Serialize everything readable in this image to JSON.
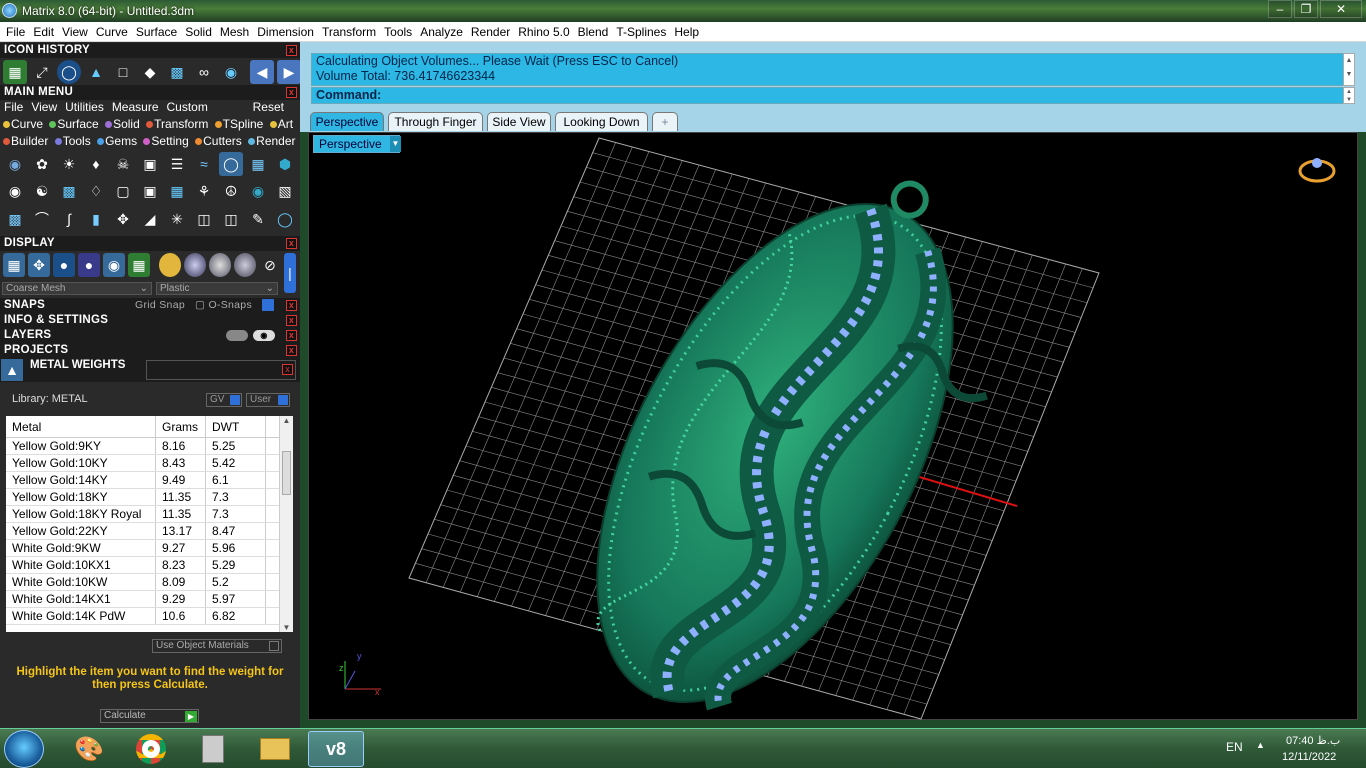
{
  "window": {
    "title": "Matrix 8.0 (64-bit) - Untitled.3dm"
  },
  "menu": [
    "File",
    "Edit",
    "View",
    "Curve",
    "Surface",
    "Solid",
    "Mesh",
    "Dimension",
    "Transform",
    "Tools",
    "Analyze",
    "Render",
    "Rhino 5.0",
    "Blend",
    "T-Splines",
    "Help"
  ],
  "left": {
    "icon_history": "ICON HISTORY",
    "main_menu": "MAIN MENU",
    "main_menu_items": [
      "File",
      "View",
      "Utilities",
      "Measure",
      "Custom"
    ],
    "reset": "Reset",
    "categories_row1": [
      {
        "label": "Curve",
        "color": "#e8c23a"
      },
      {
        "label": "Surface",
        "color": "#5fc45a"
      },
      {
        "label": "Solid",
        "color": "#9f6fd8"
      },
      {
        "label": "Transform",
        "color": "#e25a3c"
      },
      {
        "label": "TSpline",
        "color": "#f0a030"
      },
      {
        "label": "Art",
        "color": "#e6c23c"
      }
    ],
    "categories_row2": [
      {
        "label": "Builder",
        "color": "#e25a3c"
      },
      {
        "label": "Tools",
        "color": "#7a7adf"
      },
      {
        "label": "Gems",
        "color": "#4aa0e8"
      },
      {
        "label": "Setting",
        "color": "#d060c8"
      },
      {
        "label": "Cutters",
        "color": "#f08a30"
      },
      {
        "label": "Render",
        "color": "#5fb8e0"
      }
    ],
    "display": "DISPLAY",
    "mesh_option": "Coarse Mesh",
    "material_option": "Plastic",
    "snaps": "SNAPS",
    "grid_snap": "Grid Snap",
    "o_snaps": "O-Snaps",
    "info": "INFO & SETTINGS",
    "layers": "LAYERS",
    "projects": "PROJECTS",
    "metal_weights": "METAL WEIGHTS",
    "library": "Library: METAL",
    "gv": "GV",
    "user": "User",
    "columns": [
      "Metal",
      "Grams",
      "DWT"
    ],
    "rows": [
      [
        "Yellow Gold:9KY",
        "8.16",
        "5.25"
      ],
      [
        "Yellow Gold:10KY",
        "8.43",
        "5.42"
      ],
      [
        "Yellow Gold:14KY",
        "9.49",
        "6.1"
      ],
      [
        "Yellow Gold:18KY",
        "11.35",
        "7.3"
      ],
      [
        "Yellow Gold:18KY Royal",
        "11.35",
        "7.3"
      ],
      [
        "Yellow Gold:22KY",
        "13.17",
        "8.47"
      ],
      [
        "White Gold:9KW",
        "9.27",
        "5.96"
      ],
      [
        "White Gold:10KX1",
        "8.23",
        "5.29"
      ],
      [
        "White Gold:10KW",
        "8.09",
        "5.2"
      ],
      [
        "White Gold:14KX1",
        "9.29",
        "5.97"
      ],
      [
        "White Gold:14K PdW",
        "10.6",
        "6.82"
      ]
    ],
    "use_object_materials": "Use Object Materials",
    "hint": "Highlight the item you want to find the weight for then press Calculate.",
    "calculate": "Calculate"
  },
  "command": {
    "line1": "Calculating Object Volumes... Please Wait (Press ESC to Cancel)",
    "line2": "Volume Total: 736.41746623344",
    "prompt": "Command:"
  },
  "tabs": [
    "Perspective",
    "Through Finger",
    "Side View",
    "Looking Down",
    "+"
  ],
  "viewport": {
    "label": "Perspective",
    "background": "#000000",
    "model_color": "#1f8a63",
    "gem_color": "#8fb0ff"
  },
  "taskbar": {
    "lang": "EN",
    "time": "07:40 ب.ظ",
    "date": "12/11/2022",
    "active_app": "v8"
  }
}
